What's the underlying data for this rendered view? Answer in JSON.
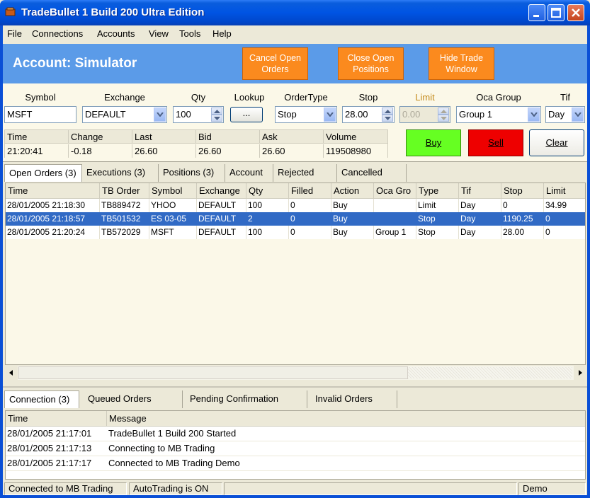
{
  "window": {
    "title": "TradeBullet 1 Build 200 Ultra Edition"
  },
  "menu": [
    "File",
    "Connections",
    "Accounts",
    "View",
    "Tools",
    "Help"
  ],
  "header": {
    "account_title": "Account: Simulator",
    "buttons": [
      {
        "line1": "Cancel Open",
        "line2": "Orders"
      },
      {
        "line1": "Close Open",
        "line2": "Positions"
      },
      {
        "line1": "Hide Trade",
        "line2": "Window"
      }
    ]
  },
  "entry": {
    "labels": {
      "symbol": "Symbol",
      "exchange": "Exchange",
      "qty": "Qty",
      "lookup": "Lookup",
      "ordertype": "OrderType",
      "stop": "Stop",
      "limit": "Limit",
      "oca": "Oca Group",
      "tif": "Tif"
    },
    "values": {
      "symbol": "MSFT",
      "exchange": "DEFAULT",
      "qty": "100",
      "lookup": "...",
      "ordertype": "Stop",
      "stop": "28.00",
      "limit": "0.00",
      "oca": "Group 1",
      "tif": "Day"
    }
  },
  "quote": {
    "headers": [
      "Time",
      "Change",
      "Last",
      "Bid",
      "Ask",
      "Volume"
    ],
    "values": [
      "21:20:41",
      "-0.18",
      "26.60",
      "26.60",
      "26.60",
      "119508980"
    ]
  },
  "trade_buttons": {
    "buy": "Buy",
    "sell": "Sell",
    "clear": "Clear"
  },
  "colors": {
    "buy": "#66ff22",
    "sell": "#ee0000",
    "accent": "#5b9be8",
    "orange": "#fb8a1e",
    "selection": "#316ac5"
  },
  "order_tabs": [
    "Open Orders (3)",
    "Executions (3)",
    "Positions (3)",
    "Account",
    "Rejected",
    "Cancelled"
  ],
  "orders": {
    "headers": [
      "Time",
      "TB Order",
      "Symbol",
      "Exchange",
      "Qty",
      "Filled",
      "Action",
      "Oca Gro",
      "Type",
      "Tif",
      "Stop",
      "Limit"
    ],
    "rows": [
      [
        "28/01/2005 21:18:30",
        "TB889472",
        "YHOO",
        "DEFAULT",
        "100",
        "0",
        "Buy",
        "",
        "Limit",
        "Day",
        "0",
        "34.99"
      ],
      [
        "28/01/2005 21:18:57",
        "TB501532",
        "ES 03-05",
        "DEFAULT",
        "2",
        "0",
        "Buy",
        "",
        "Stop",
        "Day",
        "1190.25",
        "0"
      ],
      [
        "28/01/2005 21:20:24",
        "TB572029",
        "MSFT",
        "DEFAULT",
        "100",
        "0",
        "Buy",
        "Group 1",
        "Stop",
        "Day",
        "28.00",
        "0"
      ]
    ]
  },
  "log_tabs": [
    "Connection (3)",
    "Queued Orders",
    "Pending Confirmation",
    "Invalid Orders"
  ],
  "log": {
    "headers": [
      "Time",
      "Message"
    ],
    "rows": [
      [
        "28/01/2005 21:17:01",
        "TradeBullet 1 Build 200 Started"
      ],
      [
        "28/01/2005 21:17:13",
        "Connecting to MB Trading"
      ],
      [
        "28/01/2005 21:17:17",
        "Connected to MB Trading Demo"
      ]
    ]
  },
  "status": {
    "connection": "Connected to MB Trading",
    "autotrading": "AutoTrading is ON",
    "mode": "Demo"
  }
}
